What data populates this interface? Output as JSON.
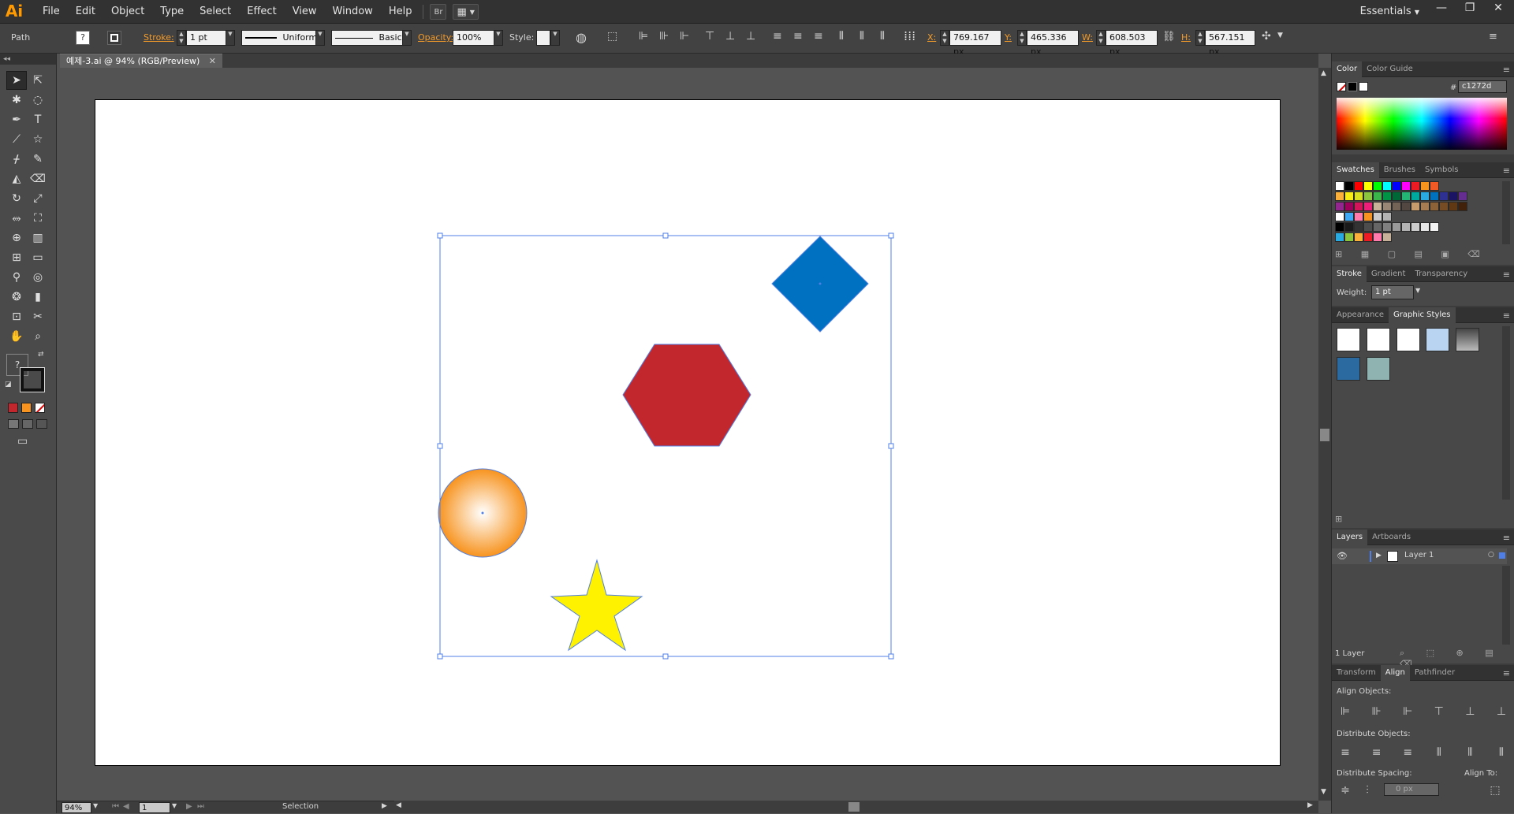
{
  "app": {
    "logo": "Ai",
    "menus": [
      "File",
      "Edit",
      "Object",
      "Type",
      "Select",
      "Effect",
      "View",
      "Window",
      "Help"
    ],
    "bridge_label": "Br",
    "workspace": "Essentials"
  },
  "control": {
    "selection_type": "Path",
    "stroke_label": "Stroke:",
    "stroke_weight": "1 pt",
    "stroke_profile": "Uniform",
    "brush": "Basic",
    "opacity_label": "Opacity:",
    "opacity": "100%",
    "style_label": "Style:",
    "x_label": "X:",
    "x": "769.167 px",
    "y_label": "Y:",
    "y": "465.336 px",
    "w_label": "W:",
    "w": "608.503 px",
    "h_label": "H:",
    "h": "567.151 px"
  },
  "document": {
    "tab_title": "예제-3.ai @ 94% (RGB/Preview)"
  },
  "status": {
    "zoom": "94%",
    "artboard": "1",
    "mode": "Selection"
  },
  "panels": {
    "color": {
      "tabs": [
        "Color",
        "Color Guide"
      ],
      "hex_symbol": "#",
      "hex": "c1272d"
    },
    "swatches": {
      "tabs": [
        "Swatches",
        "Brushes",
        "Symbols"
      ],
      "row1": [
        "#ffffff",
        "#000000",
        "#ff0000",
        "#ffff00",
        "#00ff00",
        "#00ffff",
        "#0000ff",
        "#ff00ff",
        "#ed1c24",
        "#f7941d",
        "#f15a24"
      ],
      "row2": [
        "#fbb03b",
        "#f7ec13",
        "#d9e021",
        "#8cc63f",
        "#39b54a",
        "#009245",
        "#006837",
        "#22b573",
        "#00a99d",
        "#29abe2",
        "#0071bc",
        "#2e3192",
        "#1b1464",
        "#662d91"
      ],
      "row3": [
        "#93278f",
        "#9e005d",
        "#d4145a",
        "#ed1e79",
        "#c7b299",
        "#998675",
        "#736357",
        "#534741",
        "#c69c6d",
        "#a67c52",
        "#8c6239",
        "#754c24",
        "#603813",
        "#42210b"
      ],
      "row4": [
        "#ffffff",
        "#3fa9f5",
        "#ff7bac",
        "#f7931e",
        "#cccccc",
        "#b3b3b3"
      ],
      "row5": [
        "#000000",
        "#1a1a1a",
        "#333333",
        "#4d4d4d",
        "#666666",
        "#808080",
        "#999999",
        "#b3b3b3",
        "#cccccc",
        "#e6e6e6",
        "#f2f2f2"
      ],
      "row6": [
        "#29abe2",
        "#8cc63f",
        "#fbb03b",
        "#ed1c24",
        "#ff7bac",
        "#c7b299"
      ]
    },
    "stroke": {
      "tabs": [
        "Stroke",
        "Gradient",
        "Transparency"
      ],
      "weight_label": "Weight:",
      "weight": "1 pt"
    },
    "graphic_styles": {
      "tabs": [
        "Appearance",
        "Graphic Styles"
      ]
    },
    "layers": {
      "tabs": [
        "Layers",
        "Artboards"
      ],
      "layer_name": "Layer 1",
      "count": "1 Layer"
    },
    "align": {
      "tabs": [
        "Transform",
        "Align",
        "Pathfinder"
      ],
      "align_objects": "Align Objects:",
      "distribute_objects": "Distribute Objects:",
      "distribute_spacing": "Distribute Spacing:",
      "align_to": "Align To:",
      "spacing_value": "0 px"
    }
  },
  "colors": {
    "diamond": "#0070c0",
    "hexagon": "#c1272d",
    "circle_outer": "#f7931e",
    "circle_inner": "#ffffff",
    "star": "#fff200",
    "selection": "#4f7fe6"
  }
}
